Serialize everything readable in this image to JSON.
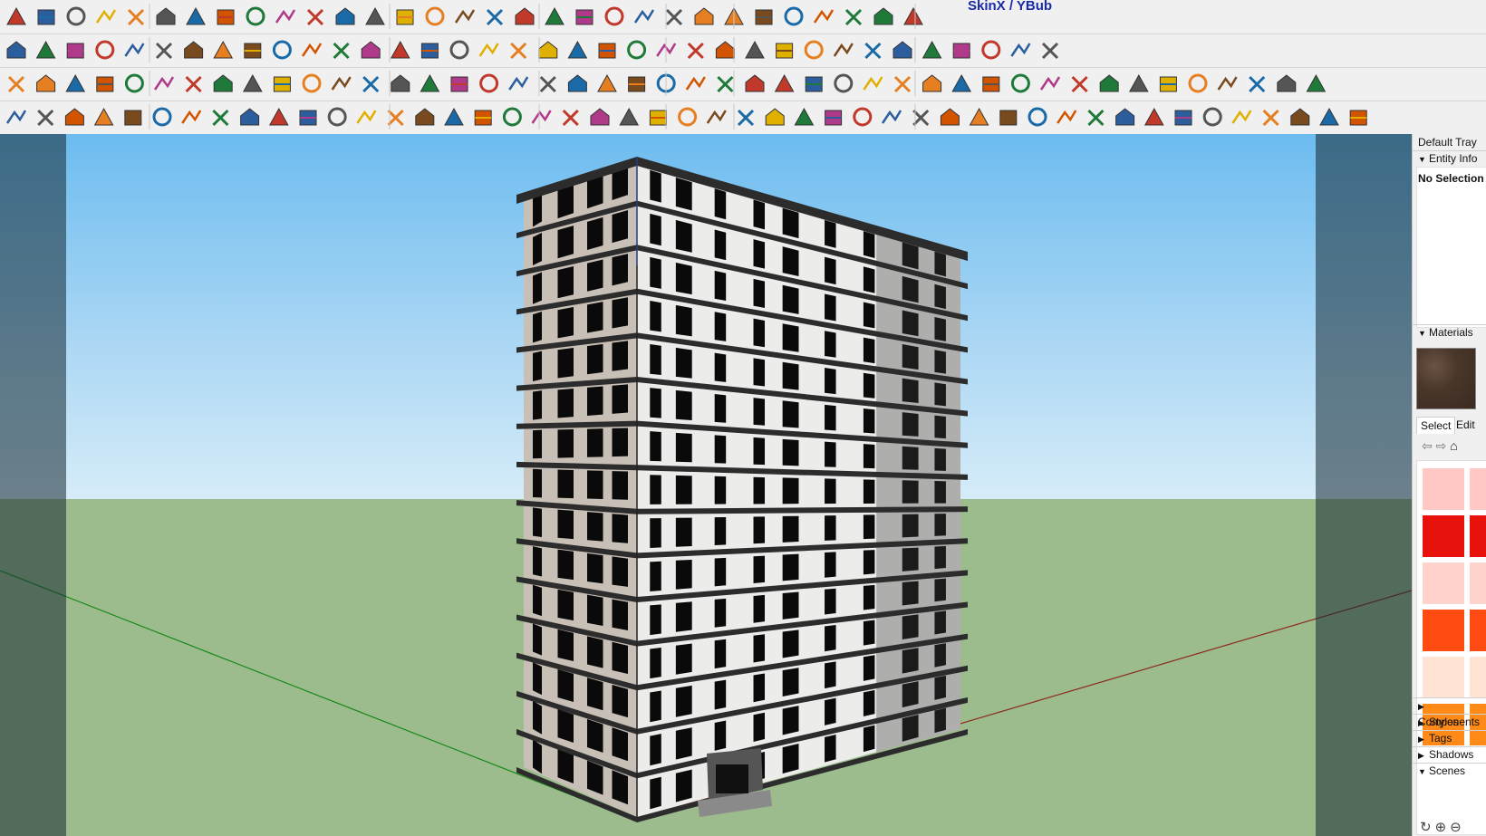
{
  "toolbar": {
    "skinx_label": "SkinX / YBub",
    "rows": [
      [
        "pencil",
        "pencil-dropdown",
        "freehand",
        "freehand-dropdown",
        "rectangle",
        "rectangle-dropdown",
        "push-pull",
        "follow-me",
        "move",
        "rotate",
        "scale",
        "tape-measure",
        "text",
        "paint-bucket",
        "orbit",
        "pan",
        "zoom",
        "zoom-extents",
        "3d-warehouse",
        "extension-warehouse",
        "layer-out",
        "extension-manager",
        "account",
        "account-dropdown",
        "map",
        "send-to-layout",
        "layers-1",
        "layers-2",
        "layers-3",
        "layers-4",
        "play",
        "stop",
        "help"
      ],
      [
        "r2-01",
        "r2-02",
        "r2-03",
        "r2-04",
        "r2-05",
        "r2-06",
        "r2-07",
        "r2-08",
        "r2-09",
        "r2-10",
        "r2-11",
        "r2-12",
        "r2-13",
        "r2-14",
        "r2-15",
        "r2-16",
        "r2-17",
        "r2-18",
        "r2-19",
        "r2-20",
        "r2-21",
        "r2-22",
        "r2-23",
        "r2-24",
        "r2-25",
        "r2-26",
        "r2-27",
        "r2-28",
        "r2-29",
        "r2-30",
        "r2-31",
        "r2-32",
        "r2-33",
        "r2-34",
        "r2-35",
        "r2-36"
      ],
      [
        "r3-01",
        "r3-02",
        "r3-03",
        "r3-04",
        "r3-05",
        "r3-06",
        "r3-07",
        "r3-08",
        "r3-09",
        "r3-10",
        "r3-11",
        "r3-12",
        "r3-13",
        "r3-14",
        "r3-15",
        "r3-16",
        "r3-17",
        "r3-18",
        "r3-19",
        "r3-20",
        "r3-21",
        "r3-22",
        "r3-23",
        "r3-24",
        "r3-25",
        "r3-26",
        "r3-27",
        "r3-28",
        "r3-29",
        "r3-30",
        "r3-31",
        "r3-32",
        "r3-33",
        "r3-34",
        "r3-35",
        "r3-36",
        "r3-37",
        "r3-38",
        "r3-39",
        "r3-40",
        "r3-41",
        "r3-42",
        "r3-43",
        "r3-44",
        "r3-45"
      ],
      [
        "r4-01",
        "r4-02",
        "r4-03",
        "r4-04",
        "r4-05",
        "r4-06",
        "r4-07",
        "r4-08",
        "r4-09",
        "r4-10",
        "r4-11",
        "r4-12",
        "r4-13",
        "r4-14",
        "r4-15",
        "r4-16",
        "r4-17",
        "r4-18",
        "r4-19",
        "r4-20",
        "r4-21",
        "r4-22",
        "r4-23",
        "r4-24",
        "r4-25",
        "r4-26",
        "r4-27",
        "r4-28",
        "r4-29",
        "r4-30",
        "r4-31",
        "r4-32",
        "r4-33",
        "r4-34",
        "r4-35",
        "r4-36",
        "r4-37",
        "r4-38",
        "r4-39",
        "r4-40",
        "r4-41",
        "r4-42",
        "r4-43",
        "r4-44",
        "r4-45",
        "r4-46",
        "r4-47"
      ]
    ]
  },
  "tray": {
    "title": "Default Tray",
    "entity_info": {
      "label": "Entity Info",
      "status": "No Selection"
    },
    "materials": {
      "label": "Materials",
      "select_tab": "Select",
      "edit_tab": "Edit",
      "swatch_colors": [
        "#ffc8c4",
        "#e8120c",
        "#ffd3cc",
        "#ff4a12",
        "#ffe4d4",
        "#ff8a18"
      ]
    },
    "collapsed_panels": [
      "Components",
      "Styles",
      "Tags",
      "Shadows"
    ],
    "scenes_label": "Scenes"
  },
  "viewport": {
    "floors": 15,
    "colors": {
      "sky_top": "#6cbcf0",
      "ground": "#9dbc8e",
      "wall_left": "#c8c0b6",
      "wall_front": "#ececea",
      "window": "#0a0a0a",
      "slab": "#2c2c2c",
      "axis_green": "#1a8a1a",
      "axis_red": "#8a2a1a"
    }
  }
}
